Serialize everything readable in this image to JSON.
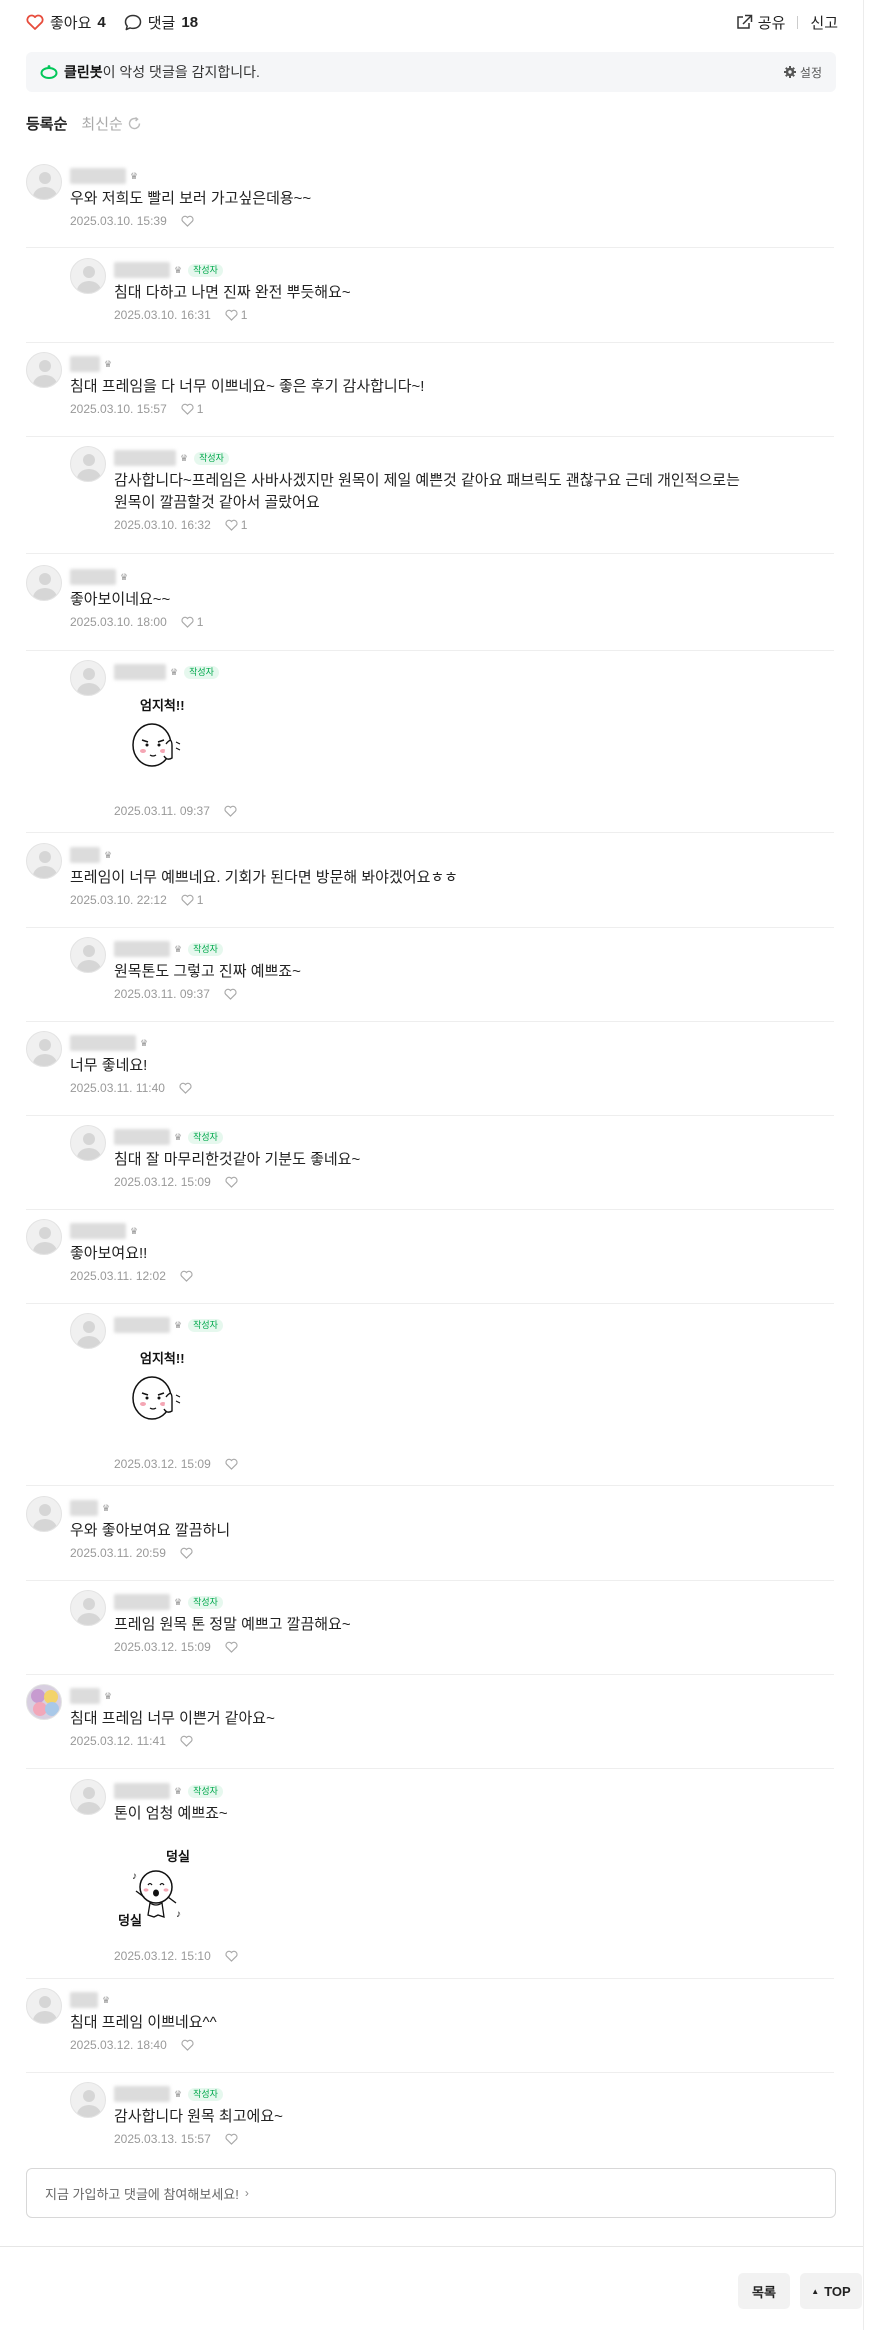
{
  "topbar": {
    "like_label": "좋아요",
    "like_count": "4",
    "comment_label": "댓글",
    "comment_count": "18",
    "share_label": "공유",
    "report_label": "신고"
  },
  "cleanbot": {
    "brand": "클린봇",
    "message": "이 악성 댓글을 감지합니다.",
    "setting_label": "설정"
  },
  "sort": {
    "active": "등록순",
    "inactive": "최신순"
  },
  "author_badge": "작성자",
  "comments": [
    {
      "text": "우와 저희도 빨리 보러 가고싶은데용~~",
      "date": "2025.03.10. 15:39",
      "likes": ""
    },
    {
      "text": "침대 다하고 나면 진짜 완전 뿌듯해요~",
      "date": "2025.03.10. 16:31",
      "likes": "1"
    },
    {
      "text": "침대 프레임을 다 너무 이쁘네요~ 좋은 후기 감사합니다~!",
      "date": "2025.03.10. 15:57",
      "likes": "1"
    },
    {
      "text": "감사합니다~프레임은 사바사겠지만 원목이 제일 예쁜것 같아요 패브릭도 괜찮구요 근데 개인적으로는\n원목이 깔끔할것 같아서 골랐어요",
      "date": "2025.03.10. 16:32",
      "likes": "1"
    },
    {
      "text": "좋아보이네요~~",
      "date": "2025.03.10. 18:00",
      "likes": "1"
    },
    {
      "text": "",
      "sticker_text": "엄지척!!",
      "date": "2025.03.11. 09:37",
      "likes": ""
    },
    {
      "text": "프레임이 너무 예쁘네요. 기회가 된다면 방문해 봐야겠어요ㅎㅎ",
      "date": "2025.03.10. 22:12",
      "likes": "1"
    },
    {
      "text": "원목톤도 그렇고 진짜 예쁘죠~",
      "date": "2025.03.11. 09:37",
      "likes": ""
    },
    {
      "text": "너무 좋네요!",
      "date": "2025.03.11. 11:40",
      "likes": ""
    },
    {
      "text": "침대 잘 마무리한것같아 기분도 좋네요~",
      "date": "2025.03.12. 15:09",
      "likes": ""
    },
    {
      "text": "좋아보여요!!",
      "date": "2025.03.11. 12:02",
      "likes": ""
    },
    {
      "text": "",
      "sticker_text": "엄지척!!",
      "date": "2025.03.12. 15:09",
      "likes": ""
    },
    {
      "text": "우와 좋아보여요 깔끔하니",
      "date": "2025.03.11. 20:59",
      "likes": ""
    },
    {
      "text": "프레임 원목 톤 정말 예쁘고 깔끔해요~",
      "date": "2025.03.12. 15:09",
      "likes": ""
    },
    {
      "text": "침대 프레임 너무 이쁜거 같아요~",
      "date": "2025.03.12. 11:41",
      "likes": ""
    },
    {
      "text": "톤이 엄청 예쁘죠~",
      "sticker_text": "덩실",
      "sticker_text2": "덩실",
      "date": "2025.03.12. 15:10",
      "likes": ""
    },
    {
      "text": "침대 프레임 이쁘네요^^",
      "date": "2025.03.12. 18:40",
      "likes": ""
    },
    {
      "text": "감사합니다 원목 최고에요~",
      "date": "2025.03.13. 15:57",
      "likes": ""
    }
  ],
  "join_prompt": "지금 가입하고 댓글에 참여해보세요!",
  "buttons": {
    "list": "목록",
    "top": "TOP"
  },
  "colors": {
    "accent": "#03c75a",
    "heart": "#e74c3c",
    "badge_bg": "#e6f8ee"
  }
}
